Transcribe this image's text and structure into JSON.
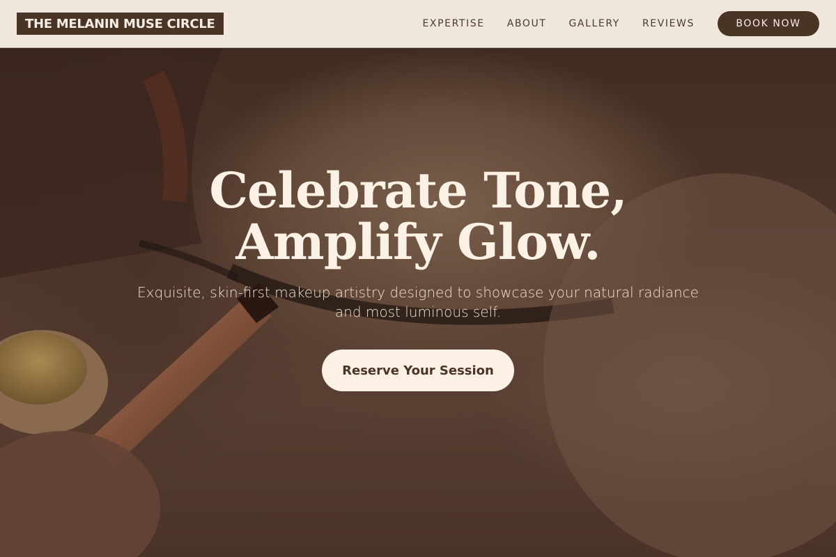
{
  "brand": {
    "name": "THE MELANIN MUSE CIRCLE"
  },
  "nav": {
    "links": [
      "EXPERTISE",
      "ABOUT",
      "GALLERY",
      "REVIEWS"
    ],
    "cta_label": "BOOK NOW"
  },
  "hero": {
    "headline_line1": "Celebrate Tone,",
    "headline_line2": "Amplify Glow.",
    "subtitle_line1": "Exquisite, skin-first makeup artistry designed to showcase your natural radiance",
    "subtitle_line2": "and most luminous self.",
    "cta_label": "Reserve Your Session",
    "image": "close-up-eye-makeup-brush-photo"
  },
  "colors": {
    "nav_bg": "#efe6dc",
    "brand_dark": "#4a3426",
    "cream": "#fbf1e4"
  }
}
